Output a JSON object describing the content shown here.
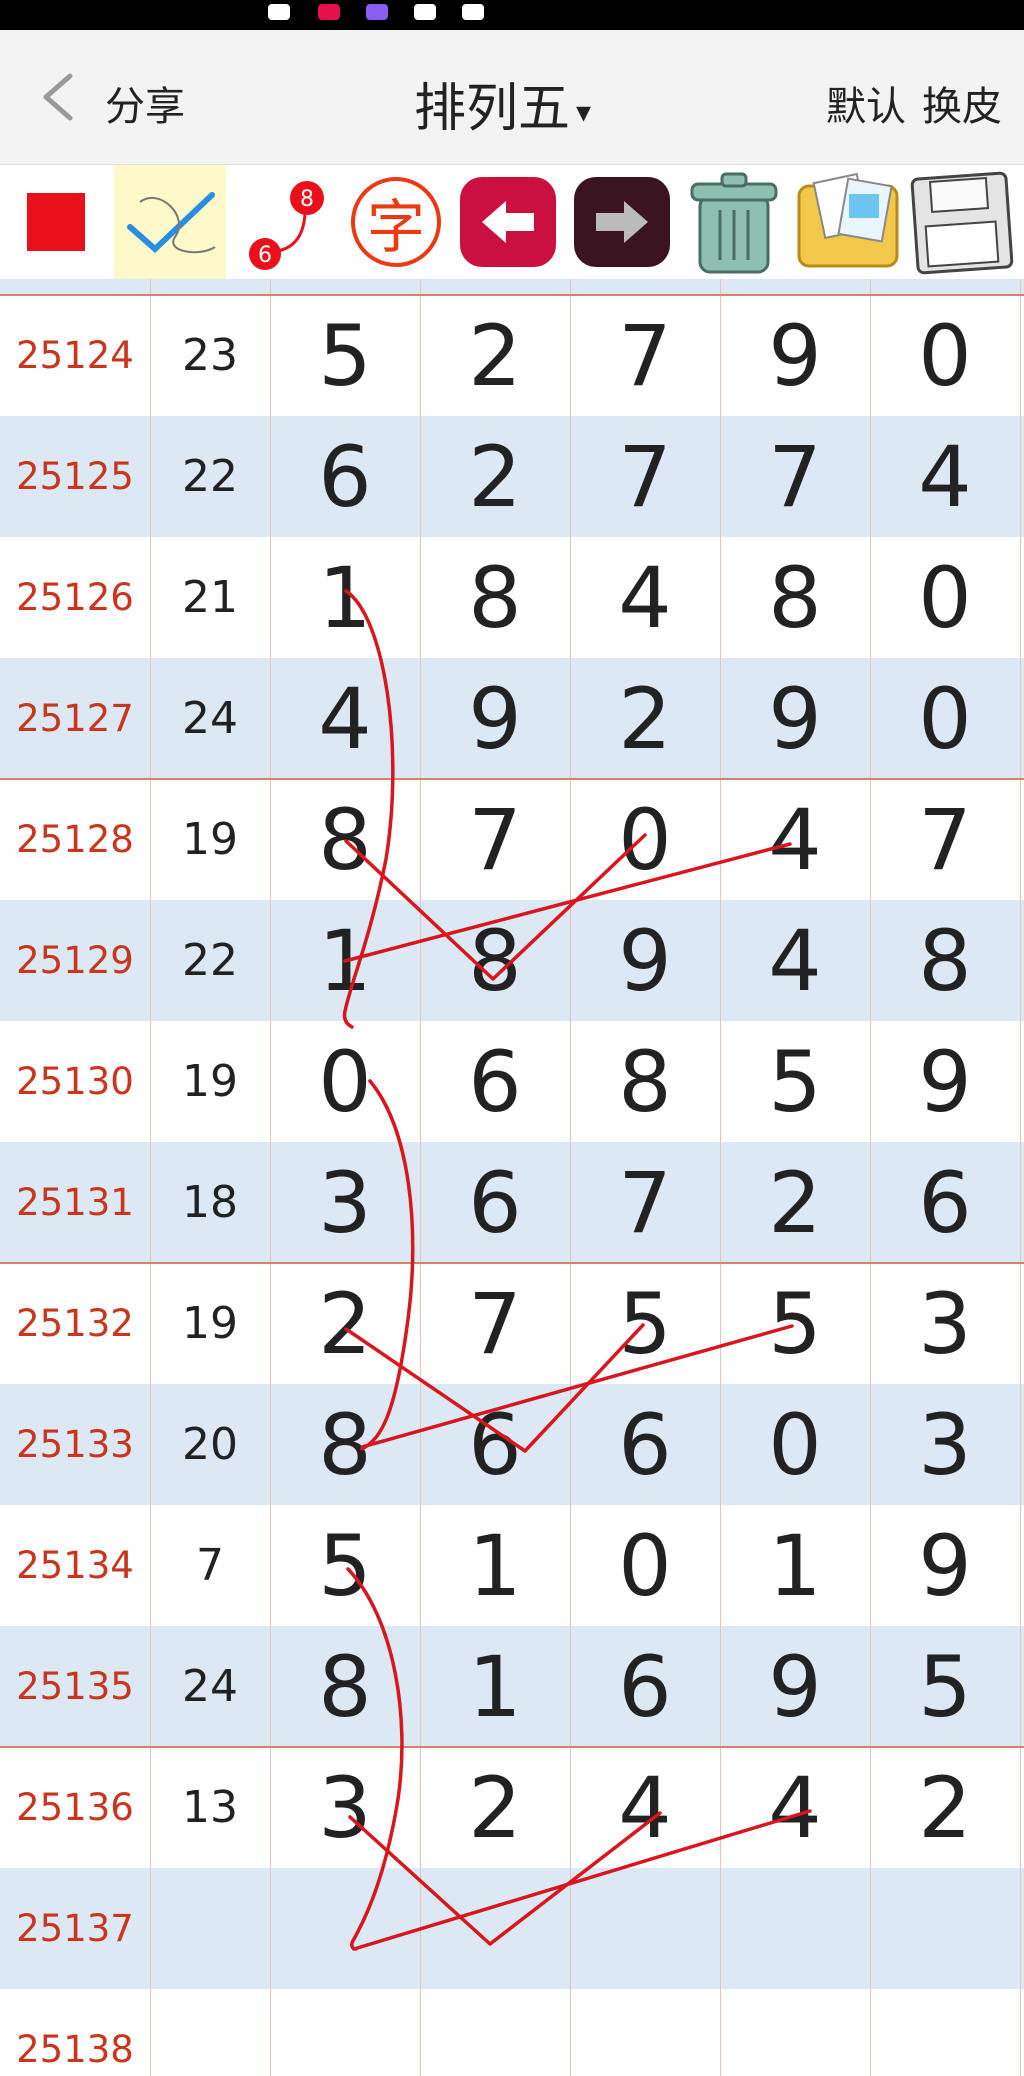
{
  "header": {
    "back_label": "<",
    "share_label": "分享",
    "title": "排列五",
    "title_caret": "▾",
    "default_label": "默认",
    "skin_label": "换皮"
  },
  "toolbar": {
    "zi_label": "字",
    "ball_top": "8",
    "ball_bottom": "6"
  },
  "rows": [
    {
      "period": "25124",
      "sum": "23",
      "digits": [
        "5",
        "2",
        "7",
        "9",
        "0"
      ]
    },
    {
      "period": "25125",
      "sum": "22",
      "digits": [
        "6",
        "2",
        "7",
        "7",
        "4"
      ]
    },
    {
      "period": "25126",
      "sum": "21",
      "digits": [
        "1",
        "8",
        "4",
        "8",
        "0"
      ]
    },
    {
      "period": "25127",
      "sum": "24",
      "digits": [
        "4",
        "9",
        "2",
        "9",
        "0"
      ]
    },
    {
      "period": "25128",
      "sum": "19",
      "digits": [
        "8",
        "7",
        "0",
        "4",
        "7"
      ]
    },
    {
      "period": "25129",
      "sum": "22",
      "digits": [
        "1",
        "8",
        "9",
        "4",
        "8"
      ]
    },
    {
      "period": "25130",
      "sum": "19",
      "digits": [
        "0",
        "6",
        "8",
        "5",
        "9"
      ]
    },
    {
      "period": "25131",
      "sum": "18",
      "digits": [
        "3",
        "6",
        "7",
        "2",
        "6"
      ]
    },
    {
      "period": "25132",
      "sum": "19",
      "digits": [
        "2",
        "7",
        "5",
        "5",
        "3"
      ]
    },
    {
      "period": "25133",
      "sum": "20",
      "digits": [
        "8",
        "6",
        "6",
        "0",
        "3"
      ]
    },
    {
      "period": "25134",
      "sum": "7",
      "digits": [
        "5",
        "1",
        "0",
        "1",
        "9"
      ]
    },
    {
      "period": "25135",
      "sum": "24",
      "digits": [
        "8",
        "1",
        "6",
        "9",
        "5"
      ]
    },
    {
      "period": "25136",
      "sum": "13",
      "digits": [
        "3",
        "2",
        "4",
        "4",
        "2"
      ]
    },
    {
      "period": "25137",
      "sum": "",
      "digits": [
        "",
        "",
        "",
        "",
        ""
      ]
    },
    {
      "period": "25138",
      "sum": "",
      "digits": [
        "",
        "",
        "",
        "",
        ""
      ]
    }
  ],
  "colors": {
    "period_text": "#c8361d",
    "row_alt": "#dce8f3",
    "draw_line": "#d8161e"
  }
}
